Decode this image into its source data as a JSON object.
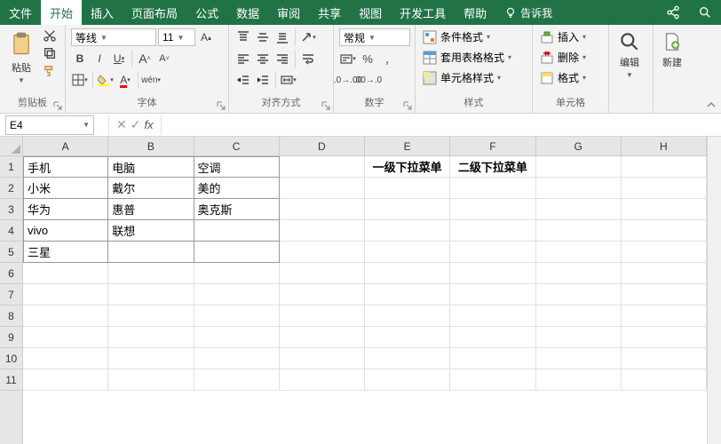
{
  "tabs": {
    "file": "文件",
    "home": "开始",
    "insert": "插入",
    "layout": "页面布局",
    "formula": "公式",
    "data": "数据",
    "review": "审阅",
    "share": "共享",
    "view": "视图",
    "dev": "开发工具",
    "help": "帮助",
    "tellme": "告诉我"
  },
  "groups": {
    "clipboard": "剪贴板",
    "font": "字体",
    "align": "对齐方式",
    "number": "数字",
    "styles": "样式",
    "cells": "单元格",
    "editing": "编辑",
    "new": "新建"
  },
  "clipboard": {
    "paste": "粘贴"
  },
  "font": {
    "name": "等线",
    "size": "11"
  },
  "number": {
    "format": "常规"
  },
  "styles": {
    "conditional": "条件格式",
    "table": "套用表格格式",
    "cell": "单元格样式"
  },
  "cells": {
    "insert": "插入",
    "delete": "删除",
    "format": "格式"
  },
  "namebox": "E4",
  "formula": "",
  "cols": [
    "A",
    "B",
    "C",
    "D",
    "E",
    "F",
    "G",
    "H"
  ],
  "rows": [
    "1",
    "2",
    "3",
    "4",
    "5",
    "6",
    "7",
    "8",
    "9",
    "10",
    "11"
  ],
  "data": {
    "A1": "手机",
    "B1": "电脑",
    "C1": "空调",
    "A2": "小米",
    "B2": "戴尔",
    "C2": "美的",
    "A3": "华为",
    "B3": "惠普",
    "C3": "奥克斯",
    "A4": "vivo",
    "B4": "联想",
    "A5": "三星",
    "E1": "一级下拉菜单",
    "F1": "二级下拉菜单"
  }
}
